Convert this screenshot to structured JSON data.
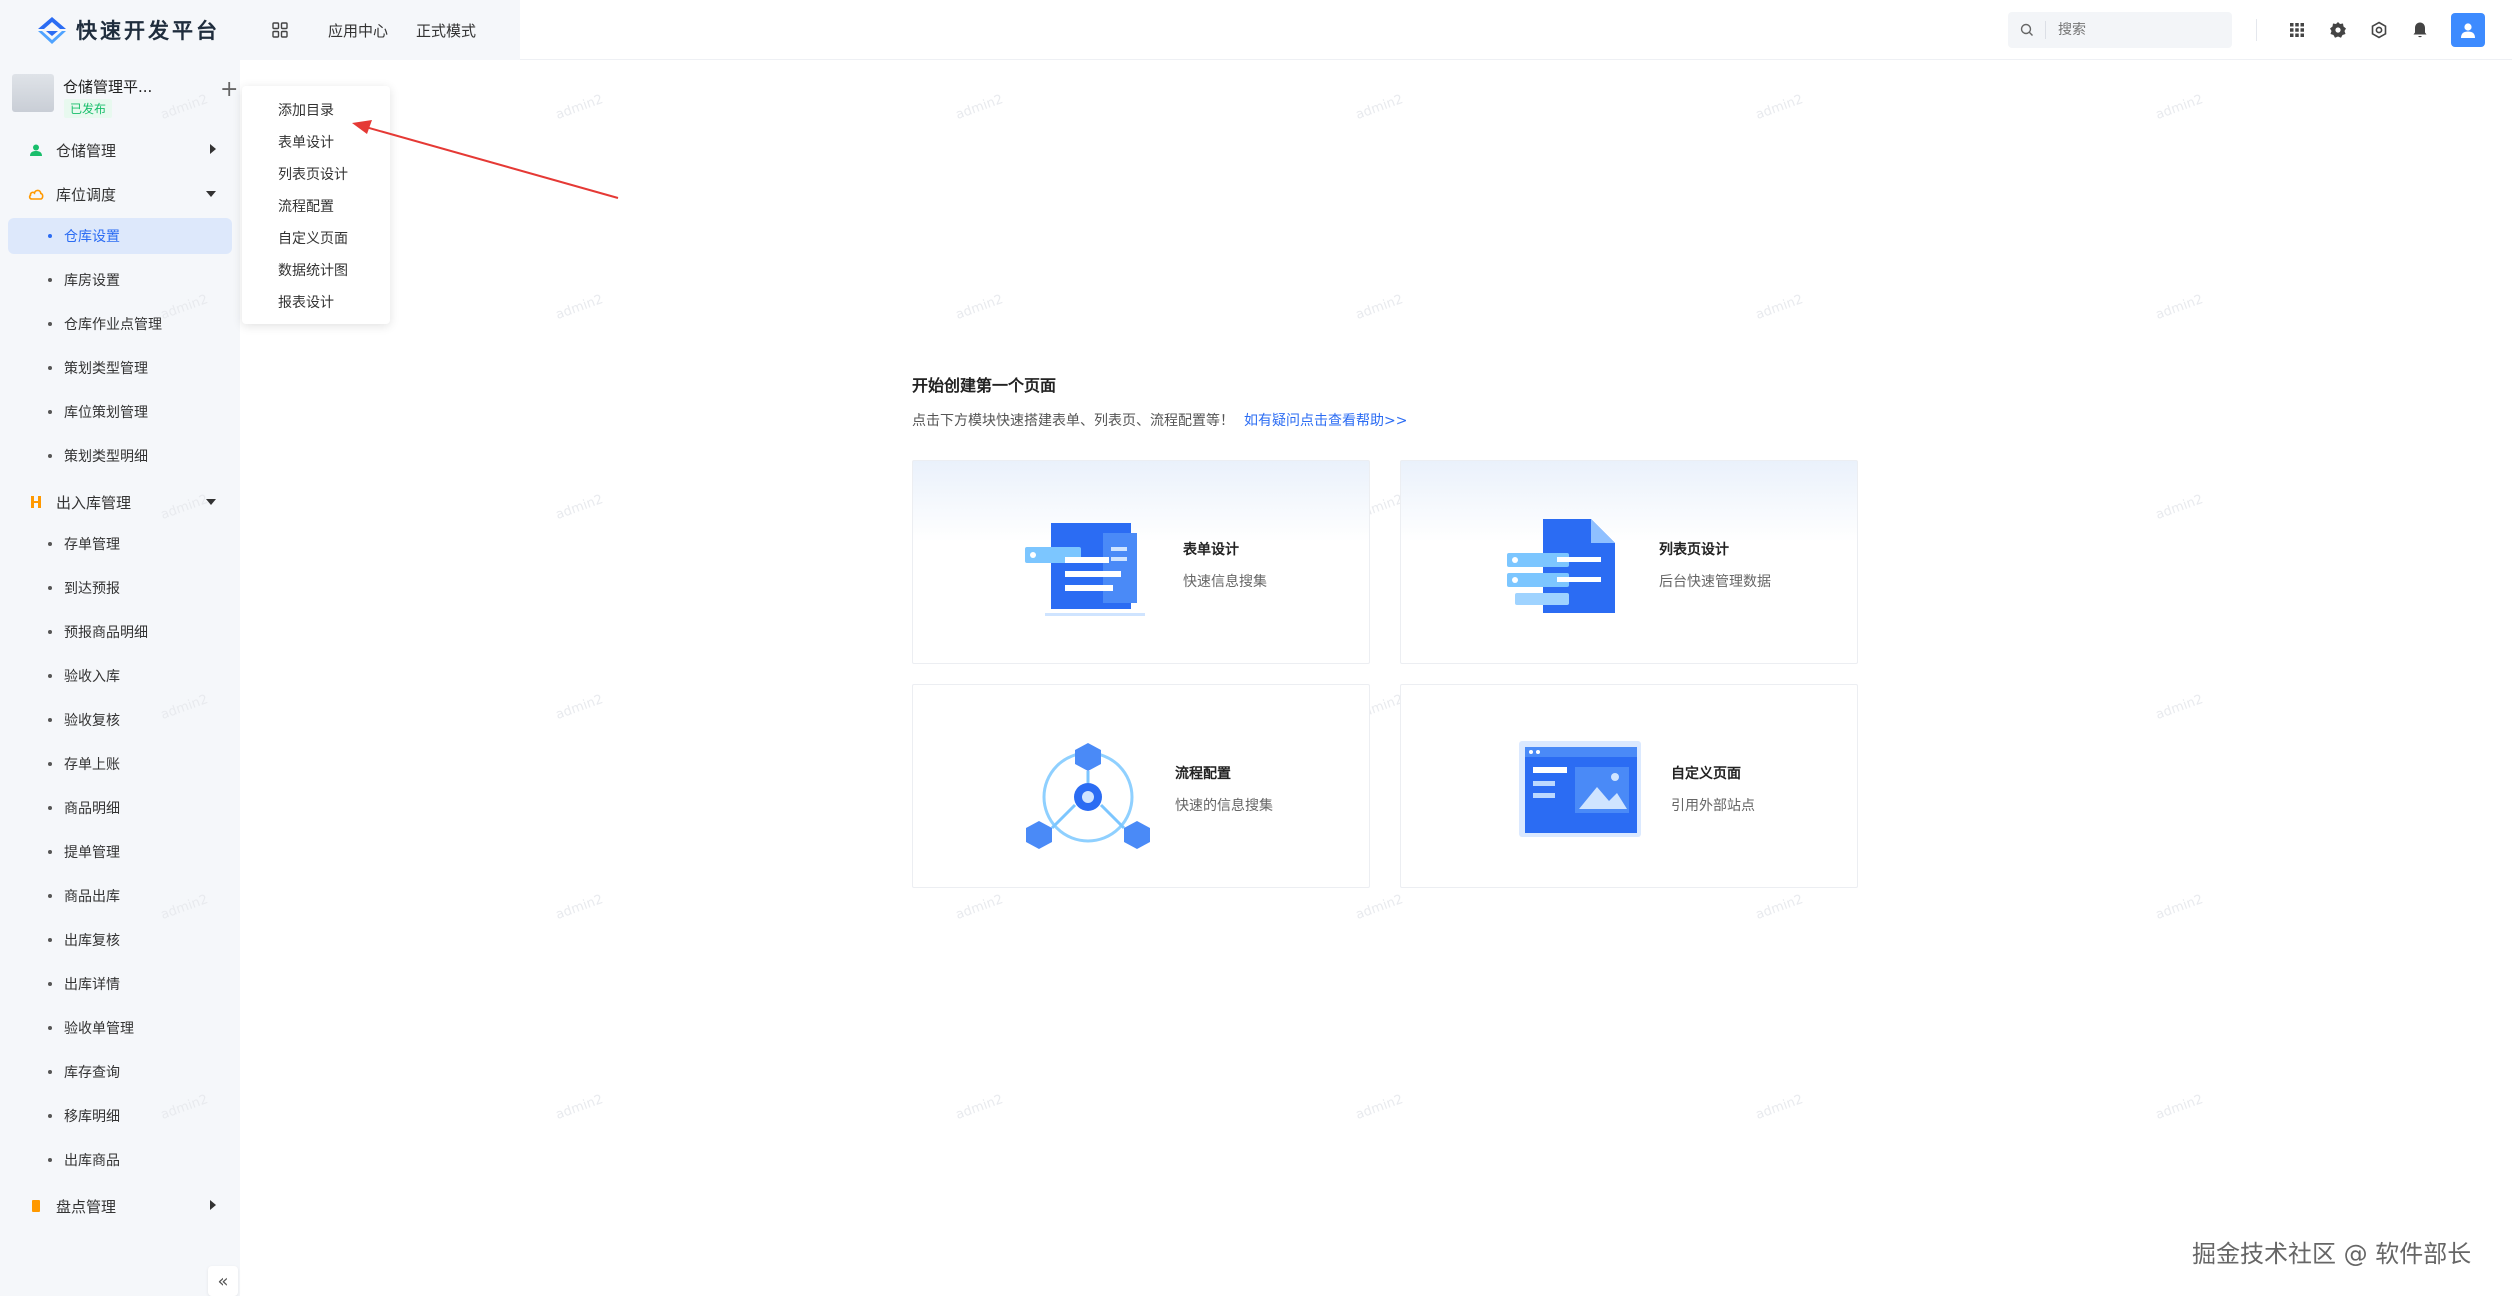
{
  "header": {
    "brand_title": "快速开发平台",
    "nav": [
      {
        "label": "应用中心"
      },
      {
        "label": "正式模式"
      }
    ],
    "search_placeholder": "搜索"
  },
  "app": {
    "name": "仓储管理平...",
    "status": "已发布"
  },
  "sidebar": {
    "groups": [
      {
        "label": "仓储管理",
        "icon": "user-group-icon",
        "color": "#19be6b",
        "expanded": false
      },
      {
        "label": "库位调度",
        "icon": "cloud-icon",
        "color": "#ff9900",
        "expanded": true,
        "items": [
          "仓库设置",
          "库房设置",
          "仓库作业点管理",
          "策划类型管理",
          "库位策划管理",
          "策划类型明细"
        ]
      },
      {
        "label": "出入库管理",
        "icon": "transfer-icon",
        "color": "#ff9900",
        "expanded": true,
        "items": [
          "存单管理",
          "到达预报",
          "预报商品明细",
          "验收入库",
          "验收复核",
          "存单上账",
          "商品明细",
          "提单管理",
          "商品出库",
          "出库复核",
          "出库详情",
          "验收单管理",
          "库存查询",
          "移库明细",
          "出库商品"
        ]
      },
      {
        "label": "盘点管理",
        "icon": "inventory-icon",
        "color": "#ff9900",
        "expanded": false
      }
    ],
    "active_item": "仓库设置",
    "collapse_label": "«"
  },
  "dropdown": {
    "items": [
      "添加目录",
      "表单设计",
      "列表页设计",
      "流程配置",
      "自定义页面",
      "数据统计图",
      "报表设计"
    ]
  },
  "main": {
    "title": "开始创建第一个页面",
    "subtitle": "点击下方模块快速搭建表单、列表页、流程配置等！",
    "help_link": "如有疑问点击查看帮助>>",
    "cards": [
      {
        "title": "表单设计",
        "desc": "快速信息搜集",
        "icon": "form-design-icon"
      },
      {
        "title": "列表页设计",
        "desc": "后台快速管理数据",
        "icon": "list-design-icon"
      },
      {
        "title": "流程配置",
        "desc": "快速的信息搜集",
        "icon": "workflow-icon"
      },
      {
        "title": "自定义页面",
        "desc": "引用外部站点",
        "icon": "custom-page-icon"
      }
    ]
  },
  "watermark_text": "admin2",
  "footer_watermark": "掘金技术社区 @ 软件部长",
  "colors": {
    "accent": "#2b6cf3",
    "sidebar_bg": "#f5f7fa",
    "arrow": "#e53935"
  }
}
